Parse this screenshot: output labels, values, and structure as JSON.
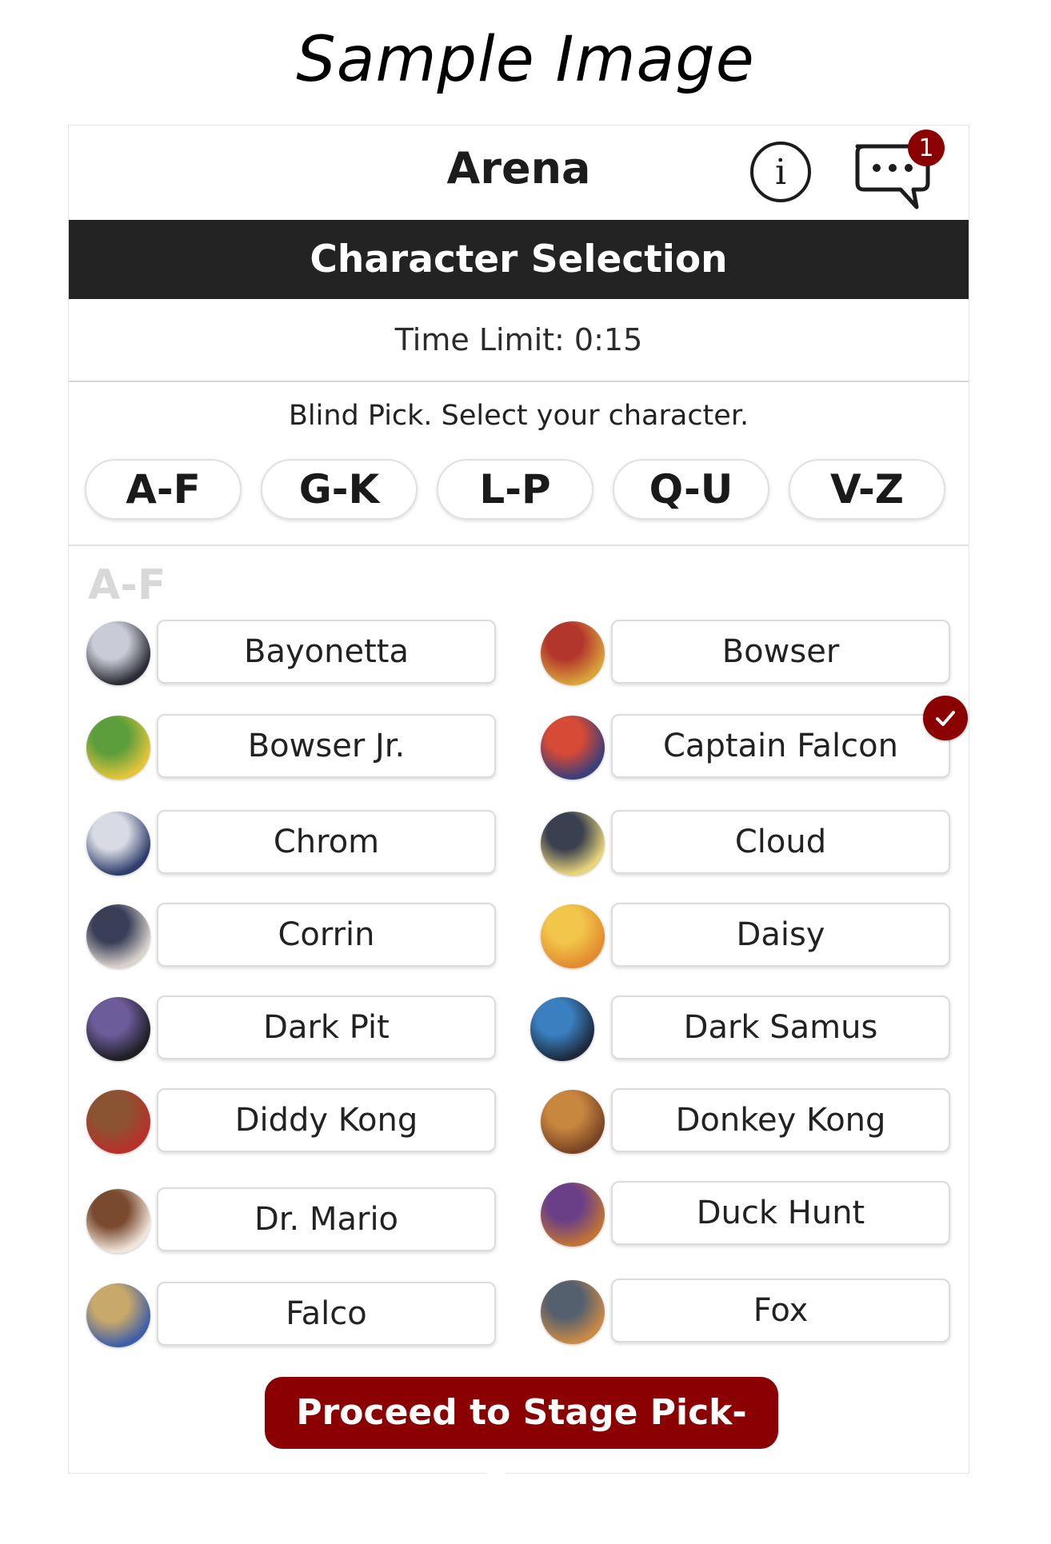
{
  "watermark": "Sample Image",
  "header": {
    "title": "Arena",
    "info_icon": "info-icon",
    "info_glyph": "i",
    "chat_icon": "chat-bubble-icon",
    "chat_badge_count": "1"
  },
  "section_title": "Character Selection",
  "timer": "Time Limit: 0:15",
  "instruction": "Blind Pick. Select your character.",
  "letter_tabs": [
    "A-F",
    "G-K",
    "L-P",
    "Q-U",
    "V-Z"
  ],
  "group_label": "A-F",
  "characters": [
    {
      "name": "Bayonetta",
      "selected": false,
      "colors": [
        "#2b2b35",
        "#c9ccd6"
      ]
    },
    {
      "name": "Bowser",
      "selected": false,
      "colors": [
        "#d9a23a",
        "#b3362c"
      ]
    },
    {
      "name": "Bowser Jr.",
      "selected": false,
      "colors": [
        "#e3c53b",
        "#5b9e3b"
      ]
    },
    {
      "name": "Captain Falcon",
      "selected": true,
      "colors": [
        "#3c3f7a",
        "#d74a36"
      ]
    },
    {
      "name": "Chrom",
      "selected": false,
      "colors": [
        "#2e3d6a",
        "#d8dbe4"
      ]
    },
    {
      "name": "Cloud",
      "selected": false,
      "colors": [
        "#e8d57a",
        "#3b4050"
      ]
    },
    {
      "name": "Corrin",
      "selected": false,
      "colors": [
        "#d9d2cc",
        "#3a3f58"
      ]
    },
    {
      "name": "Daisy",
      "selected": false,
      "colors": [
        "#e38b2f",
        "#f1c64a"
      ]
    },
    {
      "name": "Dark Pit",
      "selected": false,
      "colors": [
        "#1e1e24",
        "#6d5c9a"
      ]
    },
    {
      "name": "Dark Samus",
      "selected": false,
      "colors": [
        "#1c2a3b",
        "#3a7fbf"
      ]
    },
    {
      "name": "Diddy Kong",
      "selected": false,
      "colors": [
        "#b8312b",
        "#8a5432"
      ]
    },
    {
      "name": "Donkey Kong",
      "selected": false,
      "colors": [
        "#7a4423",
        "#c8873f"
      ]
    },
    {
      "name": "Dr. Mario",
      "selected": false,
      "colors": [
        "#f0e6dc",
        "#7a4a2f"
      ]
    },
    {
      "name": "Duck Hunt",
      "selected": false,
      "colors": [
        "#c07435",
        "#6a3f87"
      ]
    },
    {
      "name": "Falco",
      "selected": false,
      "colors": [
        "#3e5fa8",
        "#c9a96b"
      ]
    },
    {
      "name": "Fox",
      "selected": false,
      "colors": [
        "#c98a46",
        "#55606e"
      ]
    }
  ],
  "selected_check_icon": "checkmark-icon",
  "accent_color": "#8b0000",
  "proceed_label": "Proceed to Stage Pick-Ban"
}
